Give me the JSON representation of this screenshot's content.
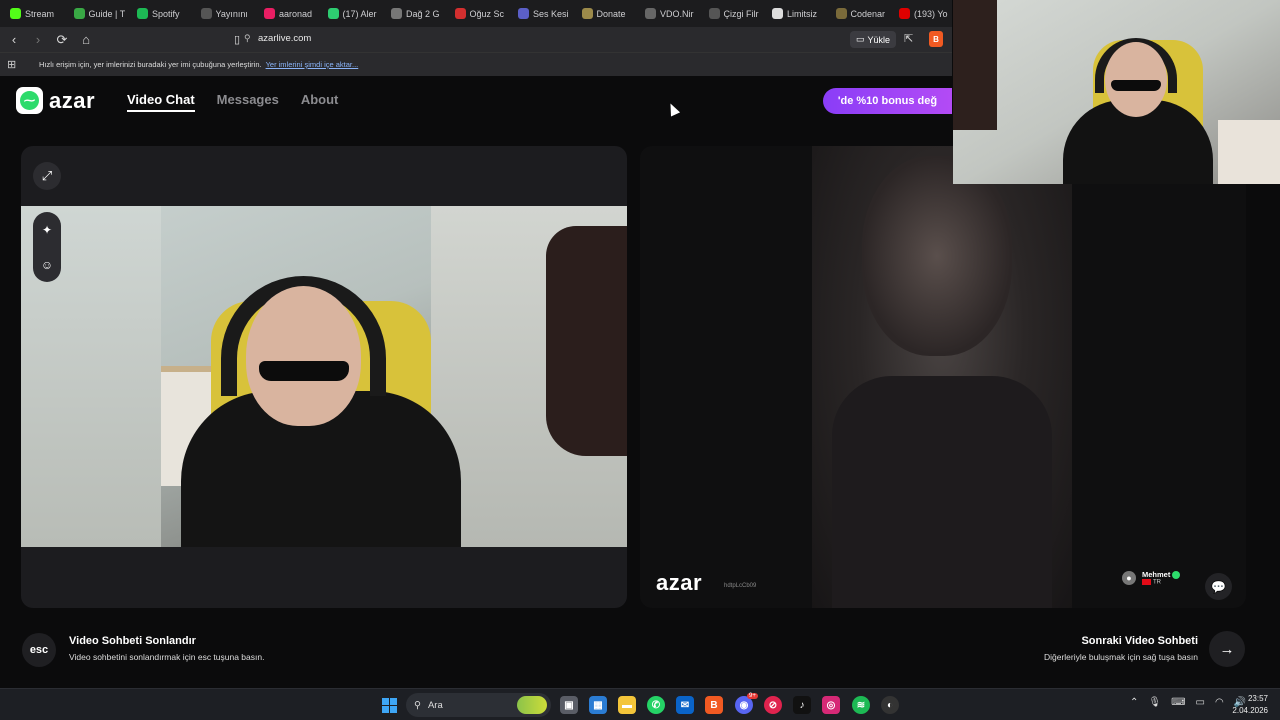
{
  "browser": {
    "tabs": [
      {
        "label": "Stream",
        "icon": "kick-icon",
        "color": "#53fc18"
      },
      {
        "label": "Guide | T",
        "icon": "grid-icon",
        "color": "#39a845"
      },
      {
        "label": "Spotify",
        "icon": "spotify-icon",
        "color": "#1db954"
      },
      {
        "label": "Yayınını",
        "icon": "bookmark-tab-icon",
        "color": "#555555"
      },
      {
        "label": "aaronad",
        "icon": "paw-icon",
        "color": "#e91e63"
      },
      {
        "label": "(17) Aler",
        "icon": "g-icon",
        "color": "#2ecc71"
      },
      {
        "label": "Dağ 2 G",
        "icon": "doc-icon",
        "color": "#777777"
      },
      {
        "label": "Oğuz Sc",
        "icon": "red-circle-icon",
        "color": "#d32f2f"
      },
      {
        "label": "Ses Kesi",
        "icon": "v-icon",
        "color": "#5b5fc7"
      },
      {
        "label": "Donate",
        "icon": "donate-icon",
        "color": "#9c8a4a"
      },
      {
        "label": "VDO.Nir",
        "icon": "vdo-icon",
        "color": "#666666"
      },
      {
        "label": "Çizgi Filr",
        "icon": "cizgi-icon",
        "color": "#555555"
      },
      {
        "label": "Limitsiz",
        "icon": "play-icon",
        "color": "#dddddd"
      },
      {
        "label": "Codenar",
        "icon": "c-icon",
        "color": "#7a6a3a"
      },
      {
        "label": "(193) Yo",
        "icon": "youtube-icon",
        "color": "#e00000"
      }
    ],
    "url": "azarlive.com",
    "install_label": "Yükle",
    "bookmarks_text": "Hızlı erişim için, yer imlerinizi buradaki yer imi çubuğuna yerleştirin.",
    "bookmarks_link": "Yer imlerini şimdi içe aktar..."
  },
  "site": {
    "logo_text": "azar",
    "nav": [
      {
        "label": "Video Chat",
        "active": true
      },
      {
        "label": "Messages",
        "active": false
      },
      {
        "label": "About",
        "active": false
      }
    ],
    "bonus_label": "'de %10 bonus değ"
  },
  "remote": {
    "watermark": "azar",
    "watermark_id": "hdtpLcCb09",
    "user_name": "Mehmet",
    "country": "TR"
  },
  "controls": {
    "esc_label": "esc",
    "end_title": "Video Sohbeti Sonlandır",
    "end_sub": "Video sohbetini sonlandırmak için esc tuşuna basın.",
    "next_title": "Sonraki Video Sohbeti",
    "next_sub": "Diğerleriyle buluşmak için sağ tuşa basın"
  },
  "taskbar": {
    "search_placeholder": "Ara",
    "time": "23:57",
    "date": "2.04.2026",
    "badge": "9+"
  }
}
